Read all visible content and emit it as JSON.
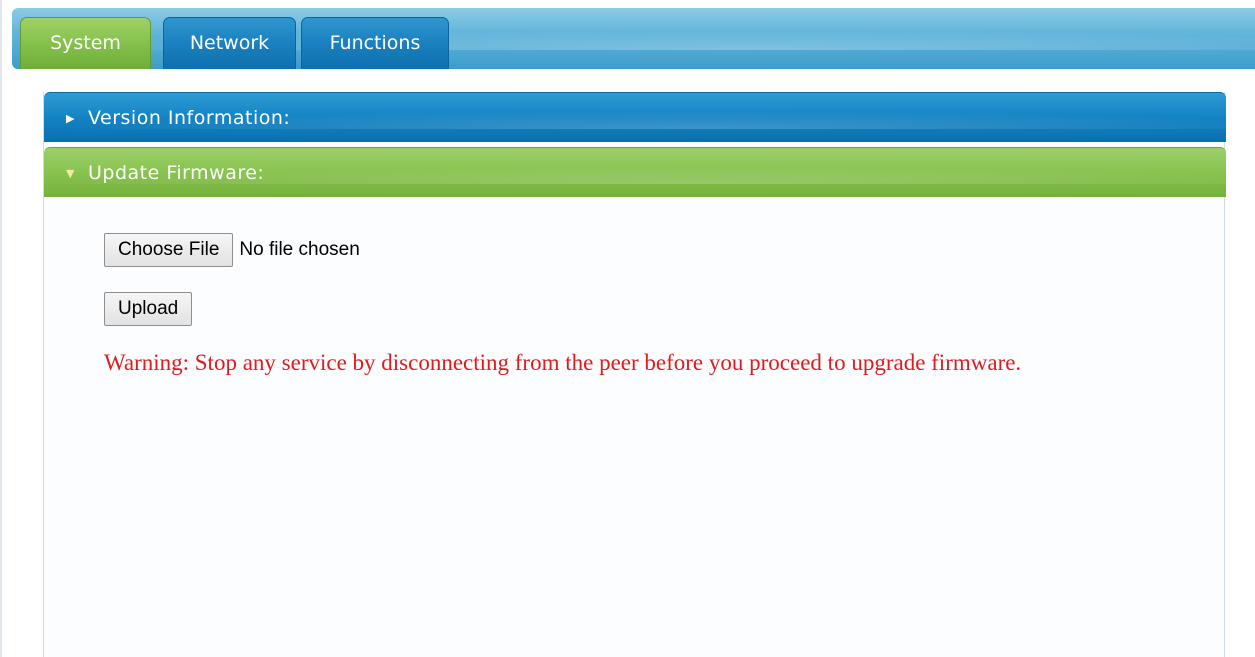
{
  "tabs": [
    {
      "label": "System",
      "active": true
    },
    {
      "label": "Network",
      "active": false
    },
    {
      "label": "Functions",
      "active": false
    }
  ],
  "sections": {
    "version": {
      "title": "Version Information:",
      "expanded": false
    },
    "firmware": {
      "title": "Update Firmware:",
      "expanded": true
    }
  },
  "firmware": {
    "choose_label": "Choose File",
    "file_status": "No file chosen",
    "upload_label": "Upload",
    "warning": "Warning: Stop any service by disconnecting from the peer before you proceed to upgrade firmware."
  },
  "icons": {
    "collapsed": "chevron-right-icon",
    "expanded": "chevron-down-icon"
  },
  "colors": {
    "active_tab": "#87c34e",
    "inactive_tab": "#1a80bf",
    "warning_text": "#e01b1b"
  }
}
